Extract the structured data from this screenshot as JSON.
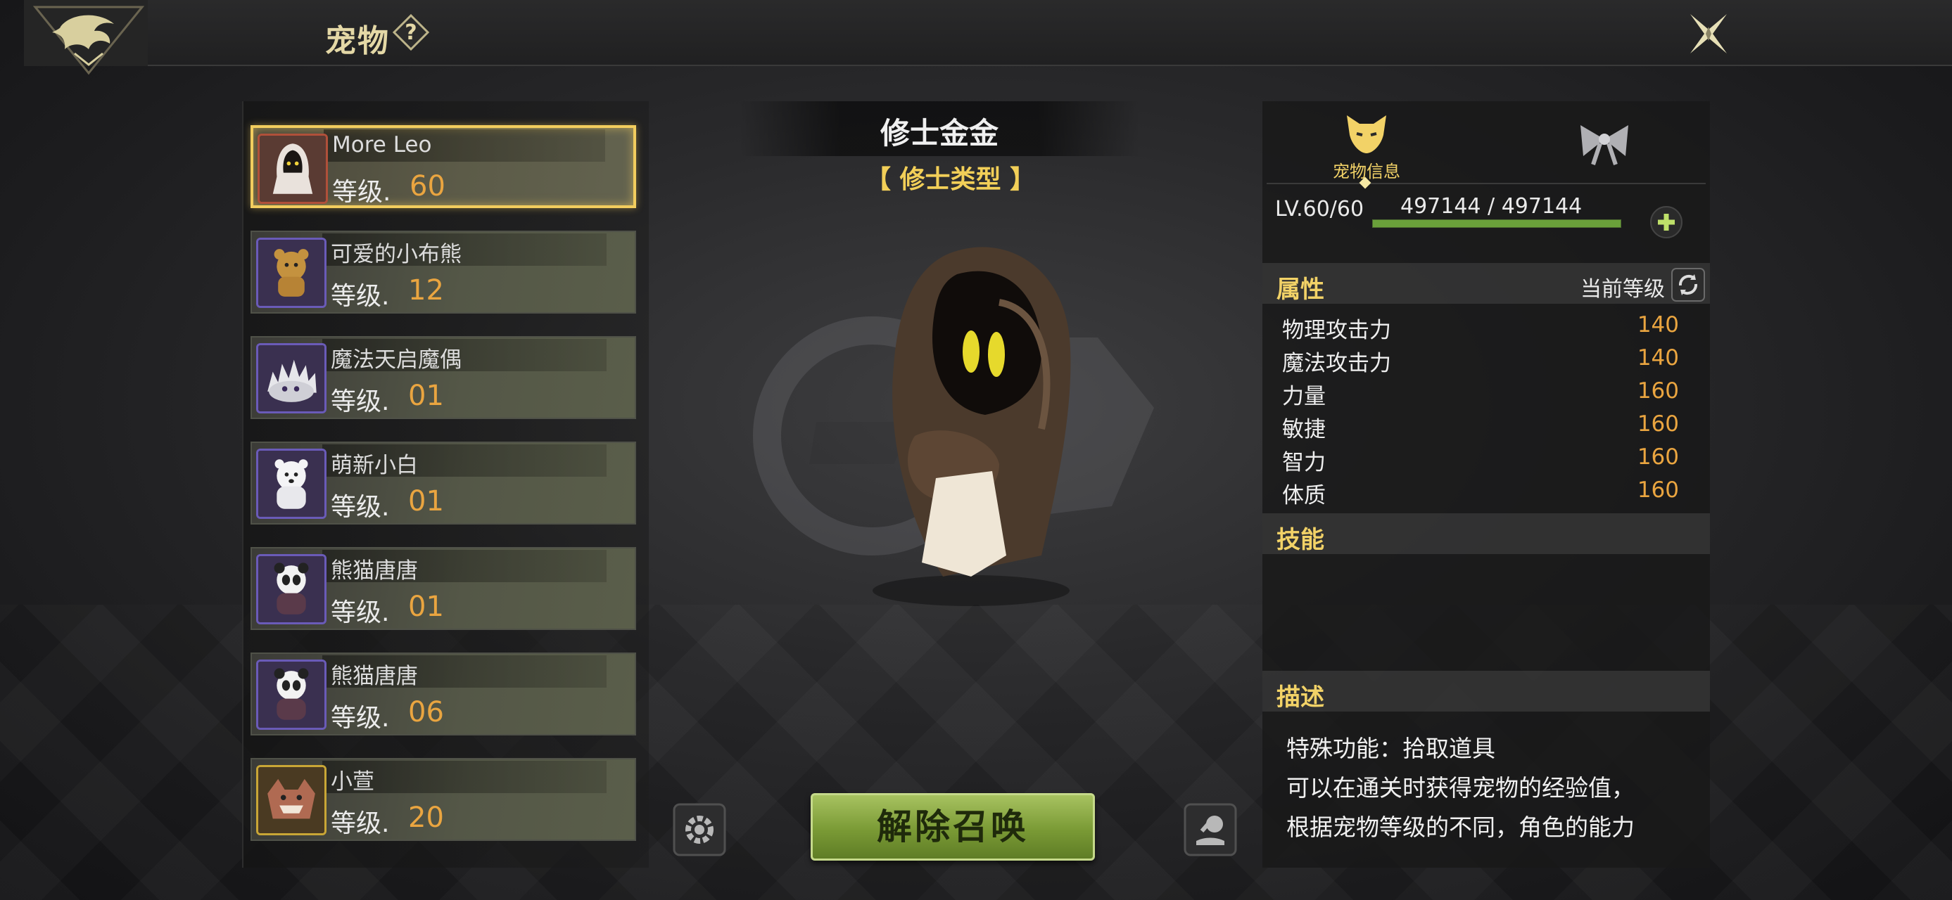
{
  "header": {
    "title": "宠物"
  },
  "pets": [
    {
      "name": "More Leo",
      "level_label": "等级.",
      "level": "60",
      "selected": true
    },
    {
      "name": "可爱的小布熊",
      "level_label": "等级.",
      "level": "12"
    },
    {
      "name": "魔法天启魔偶",
      "level_label": "等级.",
      "level": "01"
    },
    {
      "name": "萌新小白",
      "level_label": "等级.",
      "level": "01"
    },
    {
      "name": "熊猫唐唐",
      "level_label": "等级.",
      "level": "01"
    },
    {
      "name": "熊猫唐唐",
      "level_label": "等级.",
      "level": "06"
    },
    {
      "name": "小萱",
      "level_label": "等级.",
      "level": "20"
    }
  ],
  "center": {
    "pet_title": "修士金金",
    "pet_type": "【 修士类型 】",
    "dismiss_label": "解除召唤"
  },
  "info": {
    "tab_pet_info": "宠物信息",
    "level_text": "LV.60/60",
    "exp_text": "497144 / 497144",
    "exp_fraction": 1.0,
    "attributes_header": "属性",
    "current_level_label": "当前等级",
    "stats": [
      {
        "name": "物理攻击力",
        "value": "140"
      },
      {
        "name": "魔法攻击力",
        "value": "140"
      },
      {
        "name": "力量",
        "value": "160"
      },
      {
        "name": "敏捷",
        "value": "160"
      },
      {
        "name": "智力",
        "value": "160"
      },
      {
        "name": "体质",
        "value": "160"
      }
    ],
    "skills_header": "技能",
    "description_header": "描述",
    "description_lines": [
      "特殊功能：拾取道具",
      "可以在通关时获得宠物的经验值，",
      "根据宠物等级的不同，角色的能力"
    ]
  },
  "colors": {
    "accent_gold": "#f2d267",
    "level_orange": "#eaa540",
    "button_green": "#7a9a35",
    "selected_border": "#f2cd5e"
  },
  "icons": [
    "dragon-logo-icon",
    "help-icon",
    "close-icon",
    "settings-icon",
    "feed-icon",
    "fox-icon",
    "bow-icon",
    "add-icon",
    "refresh-icon"
  ]
}
